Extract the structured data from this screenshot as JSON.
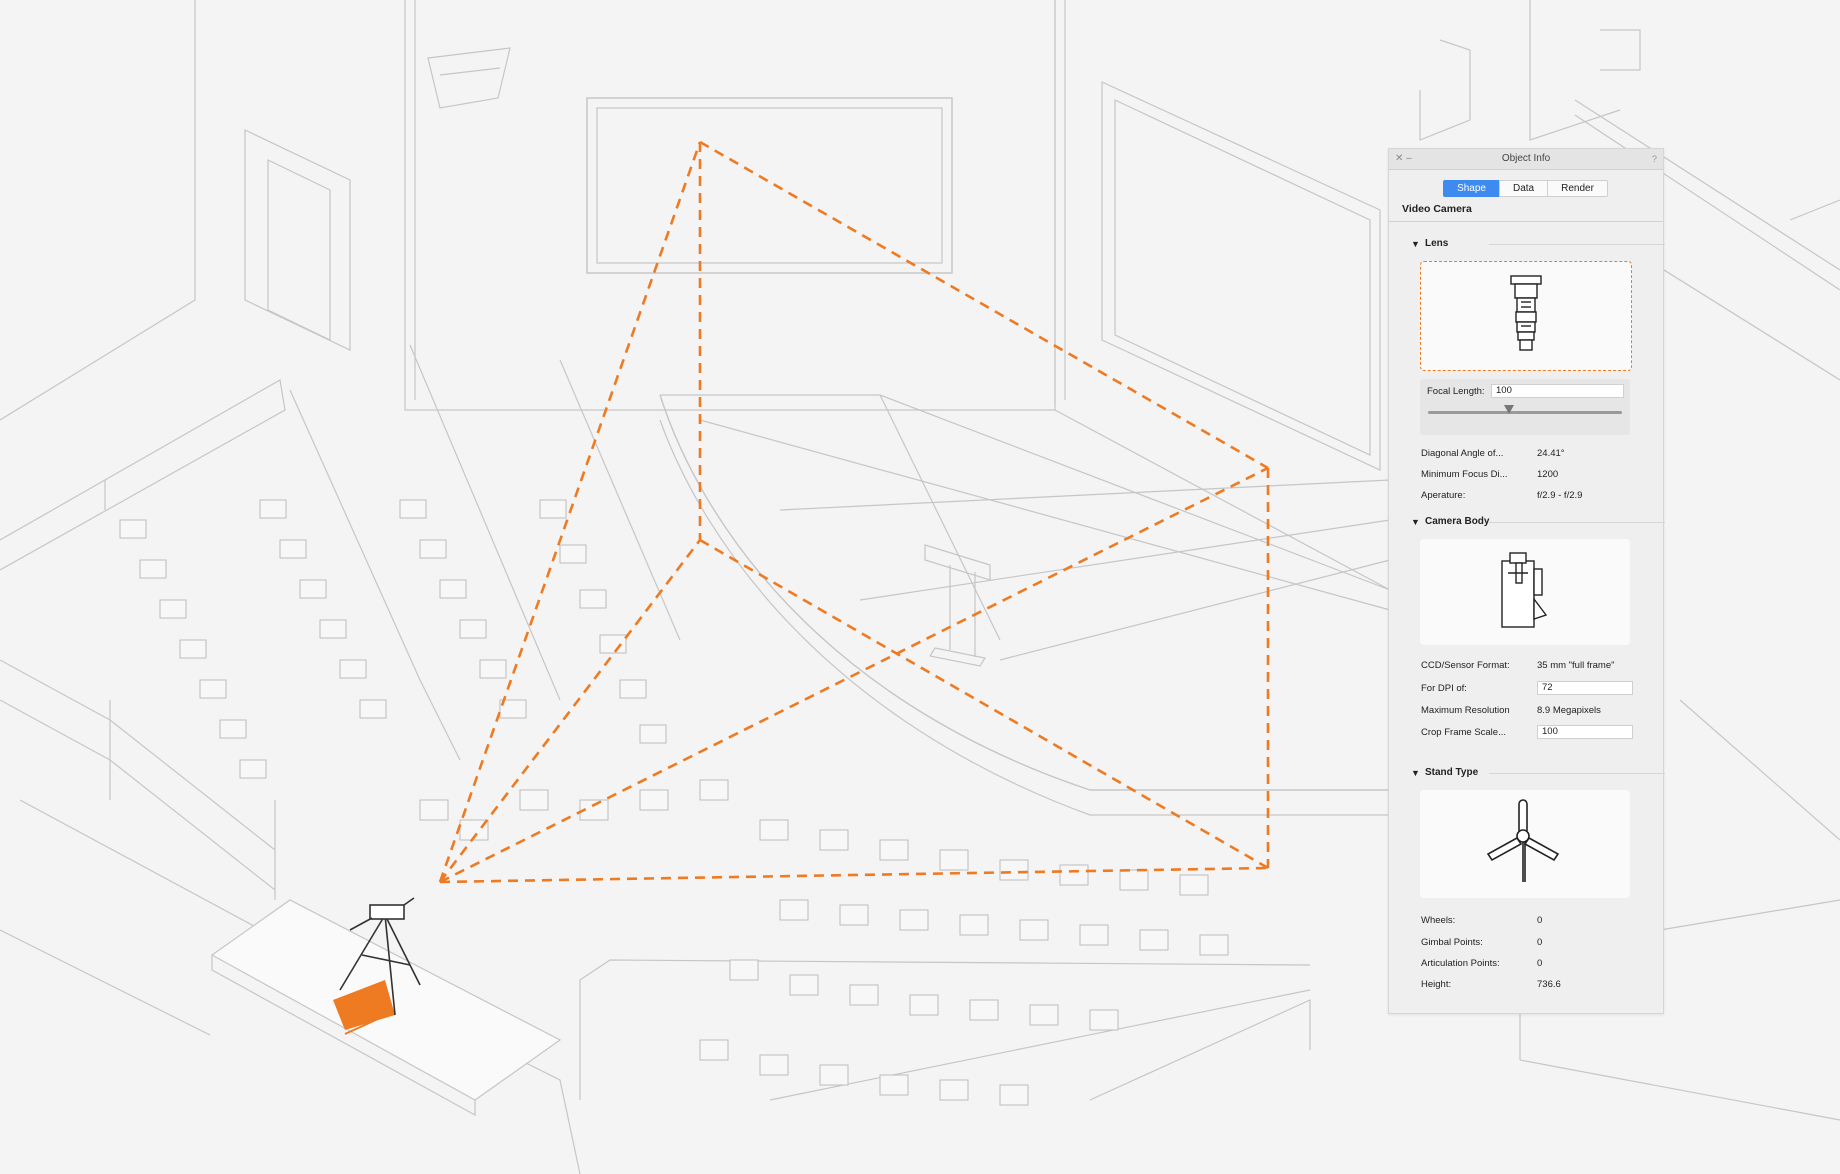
{
  "palette": {
    "title": "Object Info",
    "tabs": [
      {
        "label": "Shape",
        "active": true
      },
      {
        "label": "Data",
        "active": false
      },
      {
        "label": "Render",
        "active": false
      }
    ],
    "object_type": "Video Camera",
    "lens": {
      "header": "Lens",
      "focal_length_label": "Focal Length:",
      "focal_length_value": "100",
      "focal_slider_fraction": 0.42,
      "rows": [
        {
          "label": "Diagonal Angle of...",
          "value": "24.41°"
        },
        {
          "label": "Minimum Focus Di...",
          "value": "1200"
        },
        {
          "label": "Aperature:",
          "value": "f/2.9 - f/2.9"
        }
      ]
    },
    "camera_body": {
      "header": "Camera Body",
      "rows": [
        {
          "label": "CCD/Sensor Format:",
          "value": "35 mm \"full frame\"",
          "editable": false
        },
        {
          "label": "For DPI of:",
          "value": "72",
          "editable": true
        },
        {
          "label": "Maximum Resolution",
          "value": "8.9 Megapixels",
          "editable": false
        },
        {
          "label": "Crop Frame Scale...",
          "value": "100",
          "editable": true
        }
      ]
    },
    "stand_type": {
      "header": "Stand Type",
      "rows": [
        {
          "label": "Wheels:",
          "value": "0"
        },
        {
          "label": "Gimbal Points:",
          "value": "0"
        },
        {
          "label": "Articulation Points:",
          "value": "0"
        },
        {
          "label": "Height:",
          "value": "736.6"
        }
      ]
    }
  },
  "icons": {
    "close": "close-icon",
    "help": "help-icon",
    "disclosure": "triangle-down-icon",
    "lens": "lens-icon",
    "camera_body": "camera-body-icon",
    "tripod": "tripod-icon"
  },
  "colors": {
    "accent": "#3d8bf0",
    "frustum": "#ee7a22",
    "line": "#c4c4c4",
    "background": "#f4f4f4"
  }
}
